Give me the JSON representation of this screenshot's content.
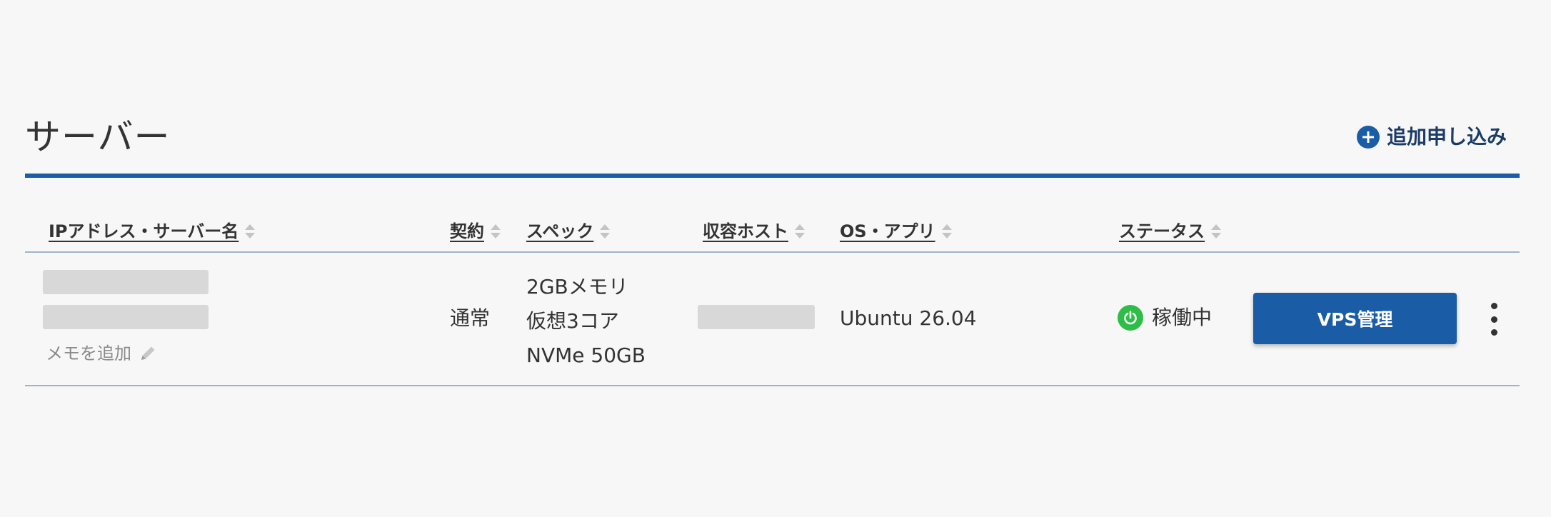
{
  "page": {
    "title": "サーバー",
    "add_label": "追加申し込み"
  },
  "colors": {
    "accent": "#1a5ca6",
    "status_running": "#2ebd47",
    "redacted": "#d8d8d8"
  },
  "table": {
    "columns": [
      {
        "key": "ip_name",
        "label": "IPアドレス・サーバー名"
      },
      {
        "key": "contract",
        "label": "契約"
      },
      {
        "key": "spec",
        "label": "スペック"
      },
      {
        "key": "host",
        "label": "収容ホスト"
      },
      {
        "key": "os",
        "label": "OS・アプリ"
      },
      {
        "key": "status",
        "label": "ステータス"
      }
    ],
    "rows": [
      {
        "memo_label": "メモを追加",
        "contract": "通常",
        "spec": [
          "2GBメモリ",
          "仮想3コア",
          "NVMe 50GB"
        ],
        "os": "Ubuntu 26.04",
        "status": "稼働中",
        "action_label": "VPS管理"
      }
    ]
  },
  "icons": {
    "add": "plus-circle-icon",
    "sort": "sort-icon",
    "memo": "pencil-icon",
    "status": "power-icon",
    "more": "kebab-menu-icon"
  }
}
